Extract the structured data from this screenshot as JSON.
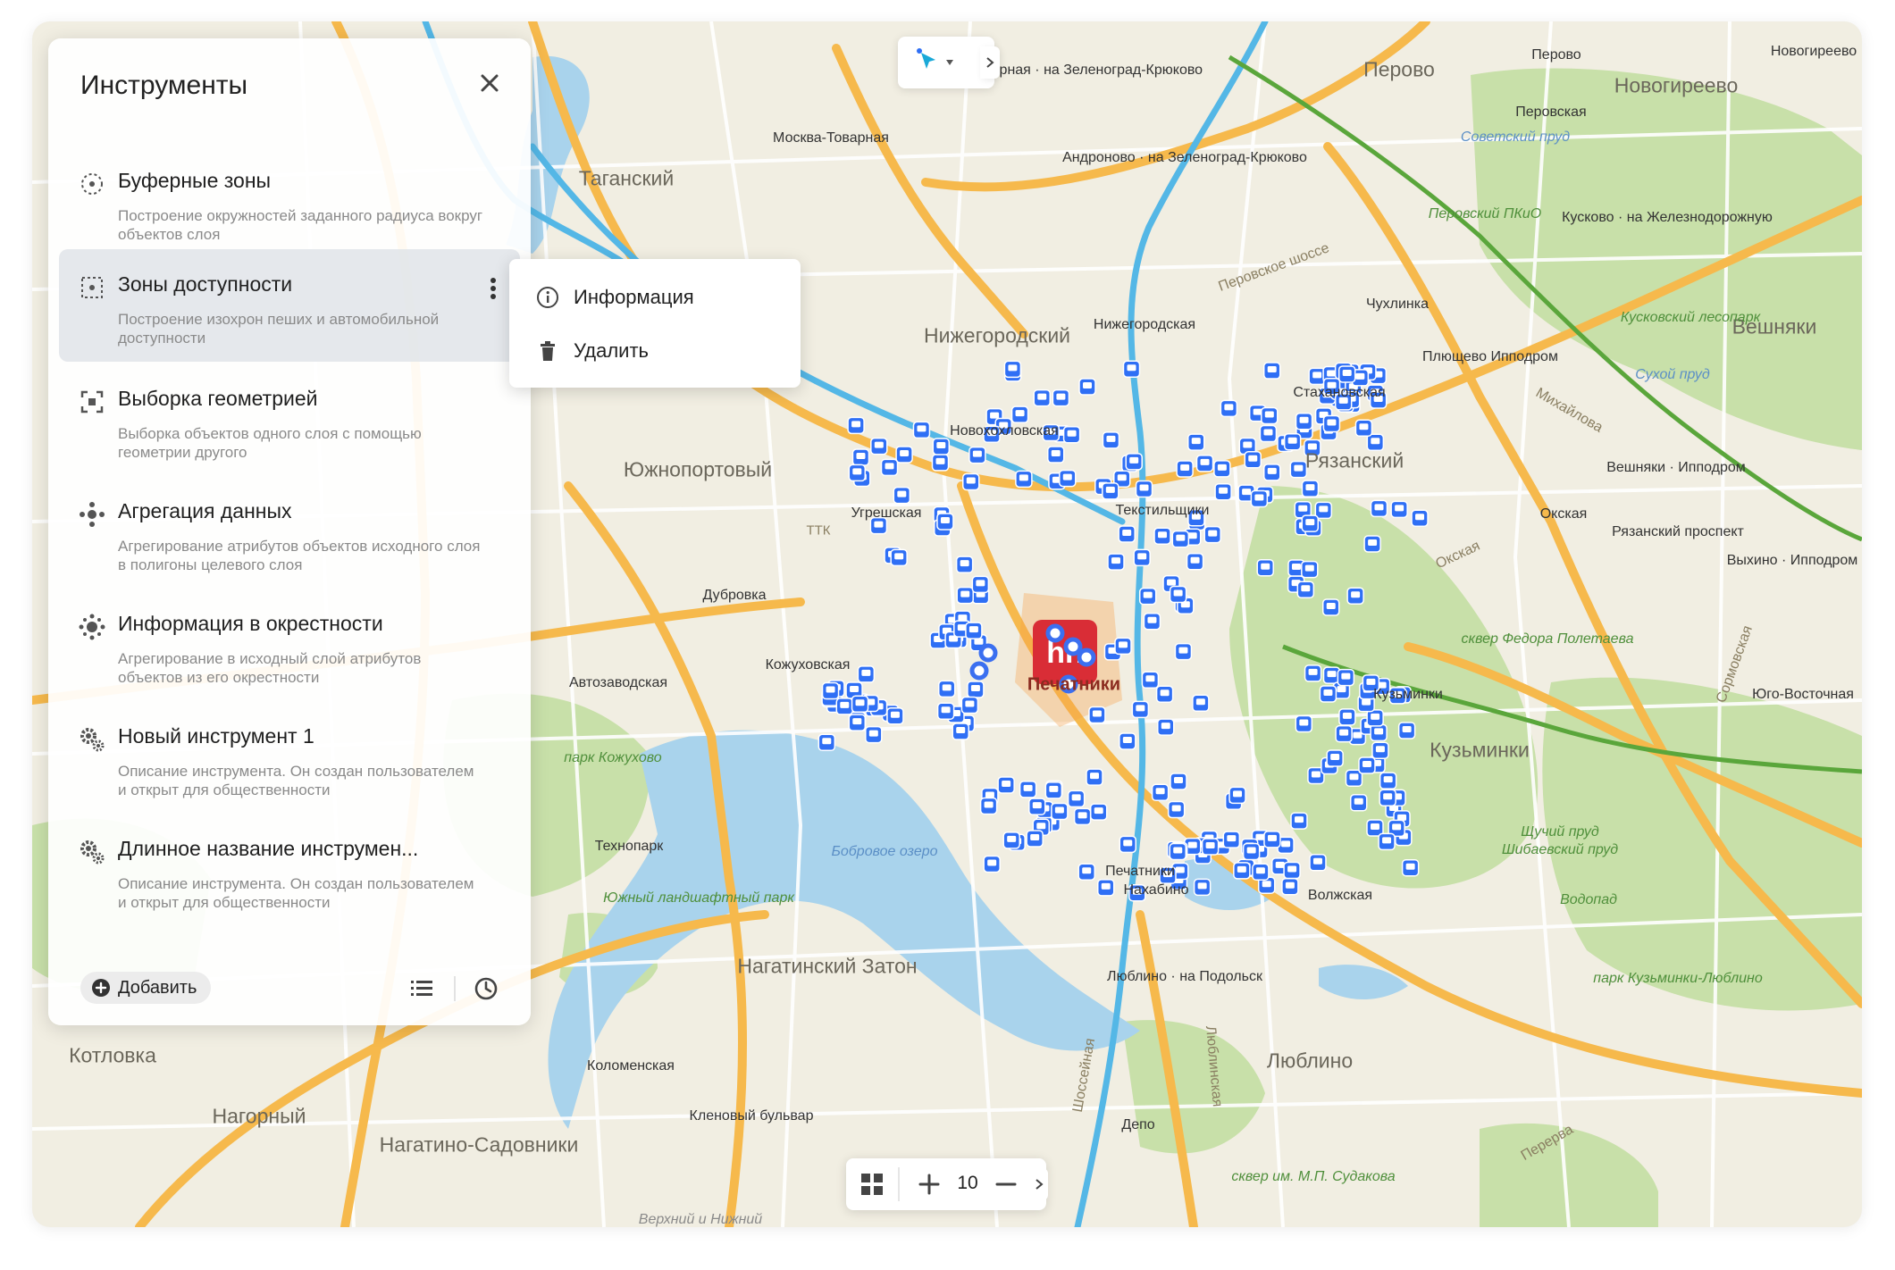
{
  "tools_panel": {
    "title": "Инструменты",
    "tools": [
      {
        "name": "Буферные зоны",
        "description": "Построение окружностей заданного радиуса вокруг объектов слоя",
        "icon": "buffer-zone-icon"
      },
      {
        "name": "Зоны доступности",
        "description": "Построение изохрон пеших и автомобильной доступности",
        "icon": "isochrone-icon"
      },
      {
        "name": "Выборка геометрией",
        "description": "Выборка объектов одного слоя с помощью геометрии другого",
        "icon": "geometry-select-icon"
      },
      {
        "name": "Агрегация данных",
        "description": "Агрегирование атрибутов объектов исходного слоя в полигоны целевого слоя",
        "icon": "aggregation-icon"
      },
      {
        "name": "Информация в окрестности",
        "description": "Агрегирование в исходный слой атрибутов объектов из его окрестности",
        "icon": "neighborhood-icon"
      },
      {
        "name": "Новый инструмент 1",
        "description": "Описание инструмента. Он создан пользователем и открыт для общественности",
        "icon": "custom-tool-icon"
      },
      {
        "name": "Длинное название инструмен...",
        "description": "Описание инструмента. Он создан пользователем и открыт для общественности",
        "icon": "custom-tool-icon"
      }
    ],
    "add_label": "Добавить"
  },
  "context_menu": {
    "items": [
      {
        "label": "Информация",
        "icon": "info-icon"
      },
      {
        "label": "Удалить",
        "icon": "trash-icon"
      }
    ]
  },
  "zoom": {
    "level": "10"
  },
  "colors": {
    "map_background": "#f1eee2",
    "water": "#a9d3ec",
    "park": "#c8e0a9",
    "arterial_road": "#f6b94c",
    "metro_line": "#54b7e6",
    "rail_green": "#5aa63b",
    "marker": "#2f6ff5",
    "brand_marker": "#d92d36"
  },
  "map": {
    "districts": [
      "Таганский",
      "Перово",
      "Новогиреево",
      "Нижегородский",
      "Южнопортовый",
      "Рязанский",
      "Вешняки",
      "Кузьминки",
      "Нагатинский Затон",
      "Люблино",
      "Нагорный",
      "Нагатино-Садовники",
      "Котловка",
      "Печатники"
    ],
    "stations": [
      "Москва-Товарная",
      "Авиамоторная · на Зеленоград-Крюково",
      "Андроново · на Зеленоград-Крюково",
      "Нижегородская",
      "Новохохловская",
      "Угрешская",
      "Текстильщики",
      "Стахановская",
      "Чухлинка",
      "Плющево Ипподром",
      "Окская",
      "Рязанский проспект",
      "Выхино · Ипподром",
      "Вешняки · Ипподром",
      "Перовская",
      "Кусково · на Железнодорожную",
      "Дубровка",
      "Кожуховская",
      "Автозаводская",
      "Технопарк",
      "Коломенская",
      "Кленовый бульвар",
      "Печатники",
      "Нахабино",
      "Волжская",
      "Люблино · на Подольск",
      "Депо",
      "Юго-Восточная",
      "Кузьминки",
      "Новогиреево",
      "Перово"
    ],
    "parks": [
      "Перовский ПКиО",
      "Кусковский лесопарк",
      "сквер Федора Полетаева",
      "парк Кожухово",
      "Южный ландшафтный парк",
      "парк Кузьминки-Люблино",
      "сквер им. М.П. Судакова",
      "Щучий пруд",
      "Шибаевский пруд",
      "Водопад"
    ],
    "water_labels": [
      "Советский пруд",
      "Сухой пруд",
      "Бобровое озеро"
    ],
    "road_labels": [
      "ТТК",
      "Перовское шоссе",
      "Михайлова",
      "Окская",
      "Шоссейная",
      "Люблинская",
      "Перерва",
      "Сормовская",
      "Верхний и Нижний"
    ],
    "brand_marker_label": "hh",
    "marker_count": 270
  }
}
